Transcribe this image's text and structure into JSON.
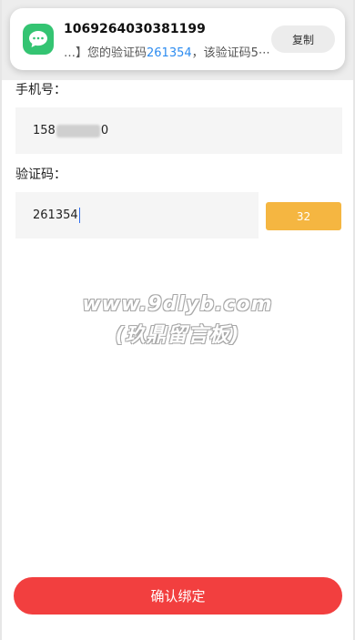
{
  "notification": {
    "sender": "1069264030381199",
    "body_prefix": "…】您的验证码",
    "body_code": "261354",
    "body_suffix": "，该验证码5⋯",
    "copy_label": "复制",
    "icon": "message-bubble-icon"
  },
  "form": {
    "phone_label": "手机号：",
    "phone_prefix": "158",
    "phone_suffix": "0",
    "code_label": "验证码：",
    "code_value": "261354",
    "countdown": "32"
  },
  "watermark": {
    "line1": "www.9dlyb.com",
    "line2": "(玖鼎留言板)"
  },
  "submit_label": "确认绑定",
  "colors": {
    "accent_red": "#f23f3f",
    "countdown_orange": "#f5b641",
    "code_blue": "#2d8cf0",
    "message_green": "#34c472"
  }
}
